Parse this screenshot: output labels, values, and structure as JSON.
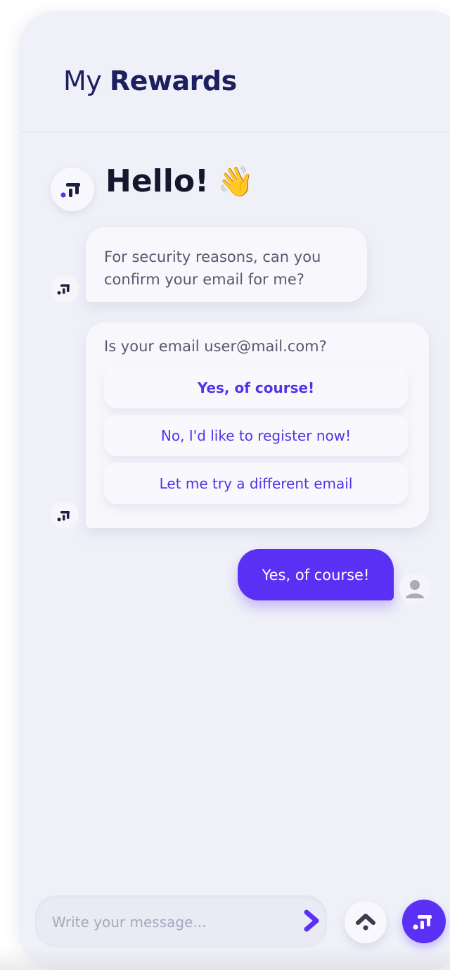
{
  "header": {
    "title_part1": "My",
    "title_part2": "Rewards"
  },
  "greeting": {
    "text": "Hello!",
    "emoji": "👋"
  },
  "messages": {
    "bot1": {
      "line1": "For security reasons, can you",
      "line2": "confirm your email for me?"
    },
    "bot2": {
      "question": "Is your email user@mail.com?",
      "options": [
        "Yes, of course!",
        "No, I'd like to register now!",
        "Let me try a different email"
      ]
    },
    "user1": {
      "text": "Yes, of course!"
    }
  },
  "composer": {
    "placeholder": "Write your message..."
  },
  "icons": {
    "brand": "brand-logo-icon",
    "user": "user-avatar-icon",
    "send": "send-chevron-icon",
    "scroll": "chevron-up-icon"
  },
  "colors": {
    "accent": "#5a30f5",
    "title": "#1d1f5e",
    "panel_bg": "#f0f1f8",
    "text_muted": "#56596e"
  }
}
